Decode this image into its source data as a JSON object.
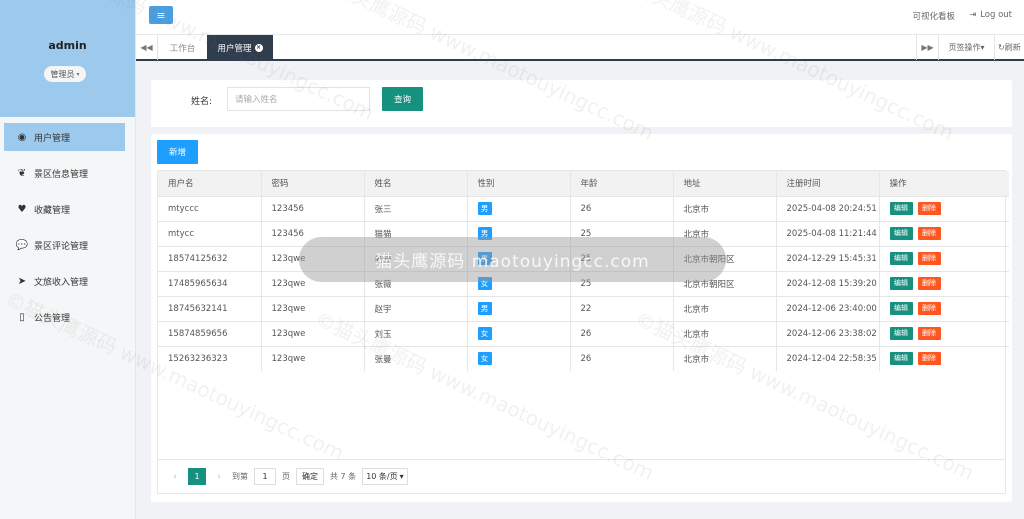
{
  "sidebar": {
    "username": "admin",
    "role": "管理员",
    "items": [
      {
        "label": "用户管理",
        "icon": "user-circle-icon",
        "active": true
      },
      {
        "label": "景区信息管理",
        "icon": "leaf-icon",
        "active": false
      },
      {
        "label": "收藏管理",
        "icon": "heart-icon",
        "active": false
      },
      {
        "label": "景区评论管理",
        "icon": "comment-icon",
        "active": false
      },
      {
        "label": "文旅收入管理",
        "icon": "paper-plane-icon",
        "active": false
      },
      {
        "label": "公告管理",
        "icon": "map-icon",
        "active": false
      }
    ]
  },
  "topbar": {
    "menu_icon": "hamburger-icon",
    "dashboard_link": "可视化看板",
    "logout_link": "Log out"
  },
  "tabs": {
    "home": "工作台",
    "active": "用户管理",
    "page_ops": "页签操作",
    "refresh": "刷新"
  },
  "search": {
    "label": "姓名:",
    "placeholder": "请输入姓名",
    "button": "查询"
  },
  "table": {
    "add_button": "新增",
    "columns": [
      "用户名",
      "密码",
      "姓名",
      "性别",
      "年龄",
      "地址",
      "注册时间",
      "操作"
    ],
    "rows": [
      {
        "username": "mtyccc",
        "password": "123456",
        "name": "张三",
        "gender": "男",
        "age": "26",
        "address": "北京市",
        "registered": "2025-04-08 20:24:51"
      },
      {
        "username": "mtycc",
        "password": "123456",
        "name": "猫猫",
        "gender": "男",
        "age": "25",
        "address": "北京市",
        "registered": "2025-04-08 11:21:44"
      },
      {
        "username": "18574125632",
        "password": "123qwe",
        "name": "老猫",
        "gender": "男",
        "age": "25",
        "address": "北京市朝阳区",
        "registered": "2024-12-29 15:45:31"
      },
      {
        "username": "17485965634",
        "password": "123qwe",
        "name": "张薇",
        "gender": "女",
        "age": "25",
        "address": "北京市朝阳区",
        "registered": "2024-12-08 15:39:20"
      },
      {
        "username": "18745632141",
        "password": "123qwe",
        "name": "赵宇",
        "gender": "男",
        "age": "22",
        "address": "北京市",
        "registered": "2024-12-06 23:40:00"
      },
      {
        "username": "15874859656",
        "password": "123qwe",
        "name": "刘玉",
        "gender": "女",
        "age": "26",
        "address": "北京市",
        "registered": "2024-12-06 23:38:02"
      },
      {
        "username": "15263236323",
        "password": "123qwe",
        "name": "张曼",
        "gender": "女",
        "age": "26",
        "address": "北京市",
        "registered": "2024-12-04 22:58:35"
      }
    ],
    "edit_label": "编辑",
    "delete_label": "删除"
  },
  "pagination": {
    "current_page": "1",
    "goto_label": "到第",
    "goto_value": "1",
    "page_unit": "页",
    "confirm": "确定",
    "total": "共 7 条",
    "page_size": "10 条/页"
  },
  "watermark": {
    "band_text": "猫头鹰源码 maotouyingcc.com",
    "tile_text": "©猫头鹰源码 www.maotouyingcc.com"
  },
  "colors": {
    "primary_teal": "#16907f",
    "primary_blue": "#1e9fff",
    "danger": "#ff5722",
    "sidebar_highlight": "#9cc9ec",
    "tab_dark": "#2f3d4d"
  }
}
